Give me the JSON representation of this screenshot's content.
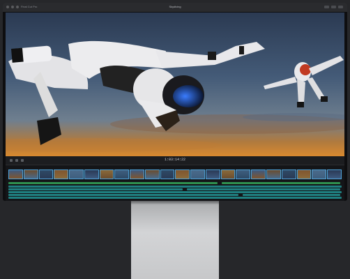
{
  "window": {
    "app_label": "Final Cut Pro",
    "title": "Skydiving"
  },
  "viewer": {
    "timecode": "1:03:14:22"
  },
  "timeline": {
    "clip_count": 22,
    "track_count": 6
  },
  "colors": {
    "clip_border": "#4fa3d9",
    "audio_track": "#1f7f80",
    "title_track": "#2f8f4e"
  }
}
